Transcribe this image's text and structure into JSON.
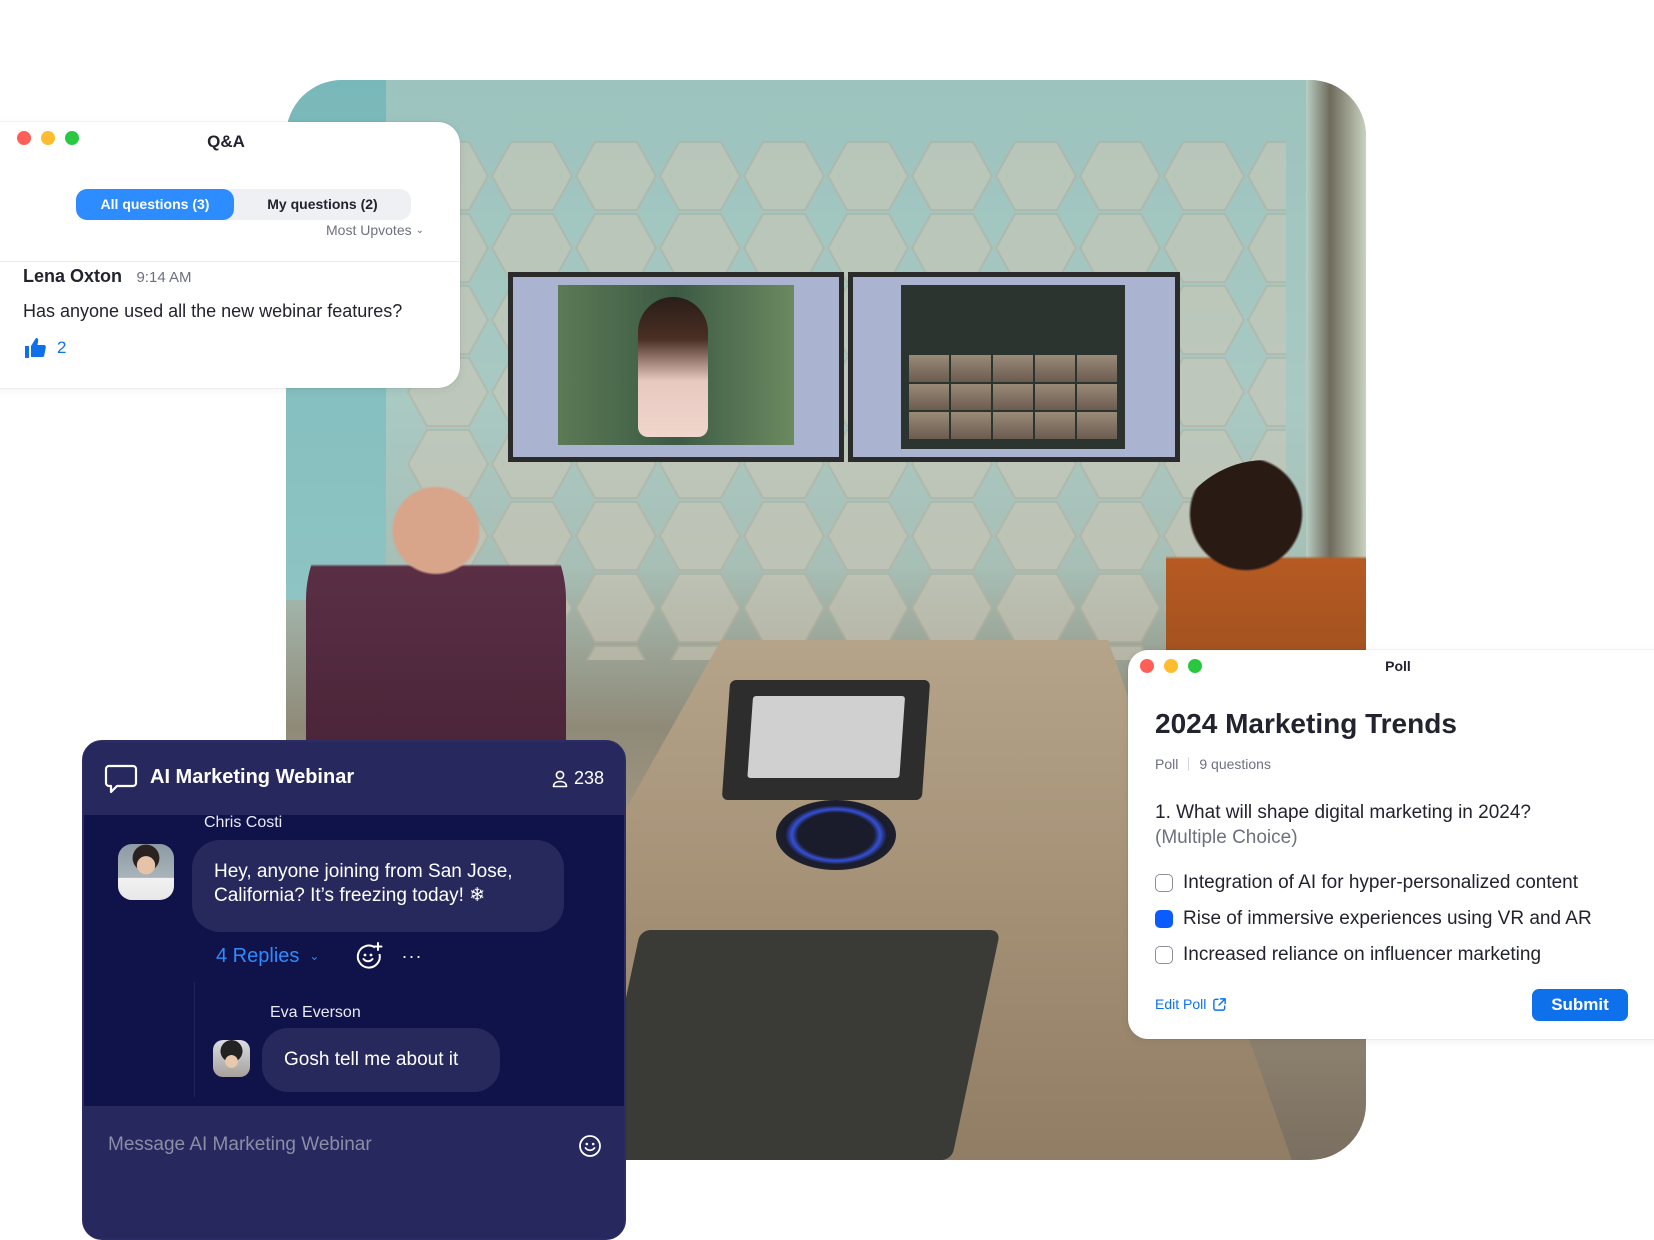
{
  "qa": {
    "title": "Q&A",
    "tabs": [
      {
        "label": "All questions (3)",
        "active": true
      },
      {
        "label": "My questions (2)",
        "active": false
      }
    ],
    "sort_label": "Most Upvotes",
    "sort_icon": "chevron-down-icon",
    "questions": [
      {
        "author": "Lena Oxton",
        "time": "9:14 AM",
        "text": "Has anyone used all the new webinar features?",
        "upvotes": "2",
        "upvote_icon": "thumbs-up-icon"
      }
    ]
  },
  "chat": {
    "title": "AI Marketing Webinar",
    "title_icon": "chat-bubble-icon",
    "participant_count": "238",
    "participant_icon": "person-icon",
    "messages": [
      {
        "author": "Chris Costi",
        "text": "Hey, anyone joining from San Jose, California? It’s freezing today! ❄",
        "replies_label": "4 Replies"
      }
    ],
    "replies": [
      {
        "author": "Eva Everson",
        "text": "Gosh tell me about it"
      }
    ],
    "input_placeholder": "Message AI Marketing Webinar",
    "more_label": "···"
  },
  "poll": {
    "window_title": "Poll",
    "title": "2024 Marketing Trends",
    "type": "Poll",
    "question_count": "9 questions",
    "question": "1. What will shape digital marketing in 2024?",
    "question_type": "(Multiple Choice)",
    "options": [
      {
        "label": "Integration of AI for hyper-personalized content",
        "checked": false
      },
      {
        "label": "Rise of immersive experiences using VR and AR",
        "checked": true
      },
      {
        "label": "Increased reliance on influencer marketing",
        "checked": false
      }
    ],
    "edit_label": "Edit Poll",
    "submit_label": "Submit"
  },
  "colors": {
    "accent_blue": "#0e71eb",
    "tab_active": "#2d8cff",
    "checkbox_checked": "#0b5cff",
    "chat_bg": "#10124a",
    "chat_header_bg": "#26285e"
  }
}
